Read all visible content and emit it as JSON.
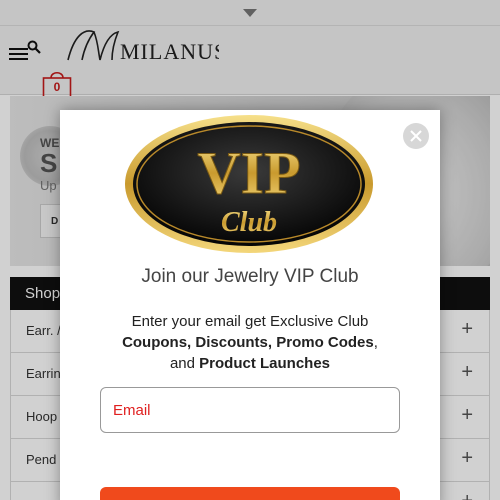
{
  "header": {
    "logo_text": "MILANUS",
    "cart_count": "0"
  },
  "banner": {
    "line1": "WE",
    "line2": "S",
    "line3": "Up",
    "button_label": "D"
  },
  "shop_bar": {
    "label": "Shop"
  },
  "categories": [
    {
      "label": "Earr. /"
    },
    {
      "label": "Earrin"
    },
    {
      "label": "Hoop"
    },
    {
      "label": "Pend"
    },
    {
      "label": ""
    }
  ],
  "category_expand_symbol": "+",
  "modal": {
    "badge_title": "VIP",
    "badge_subtitle": "Club",
    "title": "Join our Jewelry VIP Club",
    "desc_line1": "Enter your email get Exclusive Club",
    "desc_bold1": "Coupons, Discounts, Promo Codes",
    "desc_comma": ",",
    "desc_and": "and ",
    "desc_bold2": "Product Launches",
    "email_placeholder": "Email"
  },
  "colors": {
    "accent": "#f04a1c",
    "badge_red": "#c61a1a",
    "gold": "#d4a93a",
    "shop_bar": "#111111"
  }
}
